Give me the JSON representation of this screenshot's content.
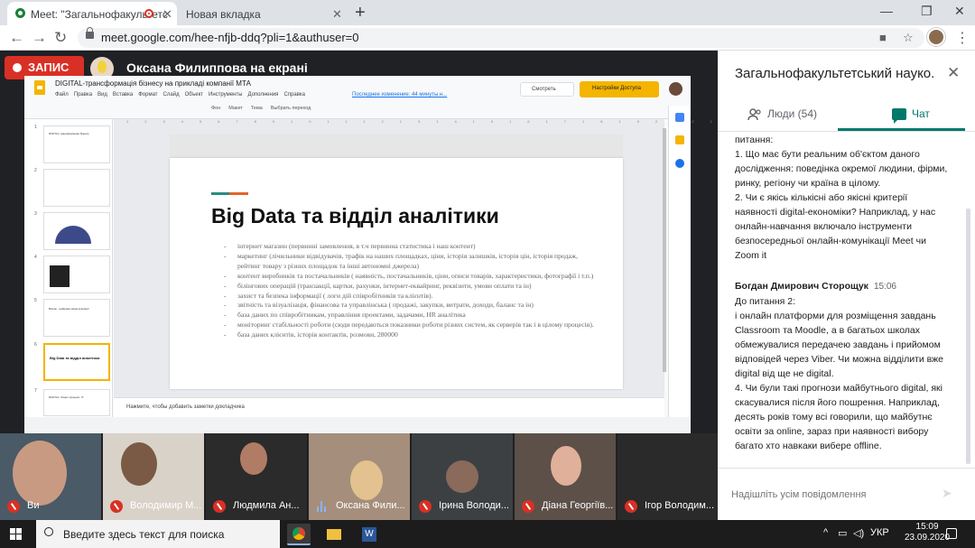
{
  "browser": {
    "tabs": [
      {
        "title": "Meet: \"Загальнофакультетс"
      },
      {
        "title": "Новая вкладка"
      }
    ],
    "url": "meet.google.com/hee-nfjb-ddq?pli=1&authuser=0"
  },
  "meet": {
    "recording_label": "ЗАПИС",
    "presenter_label": "Оксана Филиппова на екрані",
    "participants": [
      {
        "name": "Ви"
      },
      {
        "name": "Володимир М..."
      },
      {
        "name": "Людмила Ан..."
      },
      {
        "name": "Оксана Фили..."
      },
      {
        "name": "Ірина Володи..."
      },
      {
        "name": "Діана Георгіїв..."
      },
      {
        "name": "Ігор Володим..."
      }
    ]
  },
  "slides": {
    "doc_title": "DIGITAL-трансформація бізнесу на прикладі компанії МТА",
    "menu": [
      "Файл",
      "Правка",
      "Вид",
      "Вставка",
      "Формат",
      "Слайд",
      "Объект",
      "Инструменты",
      "Дополнения",
      "Справка"
    ],
    "last_edit": "Последнее изменение: 44 минуты н...",
    "present_label": "Смотреть",
    "share_label": "Настройки Доступа",
    "toolbar": [
      "Фон",
      "Макет",
      "Тема",
      "Выбрать переход"
    ],
    "thumb_numbers": [
      "1",
      "2",
      "3",
      "4",
      "5",
      "6",
      "7"
    ],
    "thumb_titles": [
      "DIGITAL-трансформація бізнесу",
      "",
      "",
      "",
      "Візник - цифрова зміна компанії",
      "Big Data та відділ аналітики",
      "DIGITAL: бізнес-процеси. ІТ"
    ],
    "slide_title": "Big Data та відділ аналітики",
    "bullets": [
      "інтернет магазин (первинні замовлення, в т.ч первинна статистика і наш контент)",
      "маркетинг (лічильники відвідувачів, трафік на наших площадках, ціни, історія залишків, історія цін, історія продаж, рейтинг товару з різних площадок та інші автономні джерела)",
      "контент виробників та постачальників ( наявність, постачальників, ціни, описи товарів, характеристики, фотографії і т.п.)",
      "білінгових операцій (транзакції, картки, рахунки, інтернет-еквайринг, реквізити, умови оплати та ін)",
      "захист та безпека інформації ( логи дій співробітників та клієнтів).",
      "звітність та візуалізація, фінансова та управлінська ( продажі, закупки, витрати, доходи, баланс та ін)",
      "база даних по співробітникам, управління проектами, задачами, HR аналітика",
      "моніторинг стабільності роботи (сюди передаються показники роботи різних систем, як серверів так і в цілому процесів).",
      "база даних клієнтів, історія контактів, розмови, 280000"
    ],
    "notes_placeholder": "Нажмите, чтобы добавить заметки докладчика"
  },
  "chat": {
    "title": "Загальнофакультетський науко...",
    "tab_people": "Люди (54)",
    "tab_chat": "Чат",
    "messages": [
      {
        "sender": "",
        "time": "",
        "text": "питання:\n1. Що має бути реальним об'єктом даного дослідження: поведінка окремої людини, фірми, ринку, регіону чи країна в цілому.\n2. Чи є якісь кількісні або якісні критерії наявності digital-економіки? Наприклад, у нас онлайн-навчання включало інструменти безпосередньої онлайн-комунікації Meet чи Zoom it"
      },
      {
        "sender": "Богдан Дмирович Сторощук",
        "time": "15:06",
        "text": "До питання 2:\nі онлайн платформи для розміщення завдань Classroom та Moodle, а в багатьох школах обмежувалися передачею завдань і прийомом відповідей через Viber. Чи можна відділити вже digital від ще не digital.\n4. Чи були такі прогнози майбутнього digital, які скасувалися після його пошрення. Наприклад, десять років тому всі говорили, що майбутнє освіти за online, зараз при наявності вибору багато хто навкаки вибере offline."
      }
    ],
    "input_placeholder": "Надішліть усім повідомлення"
  },
  "taskbar": {
    "search_placeholder": "Введите здесь текст для поиска",
    "language": "УКР",
    "time": "15:09",
    "date": "23.09.2020"
  },
  "colors": {
    "meet_green": "#00796b",
    "record_red": "#d93025",
    "slides_yellow": "#f4b400"
  }
}
